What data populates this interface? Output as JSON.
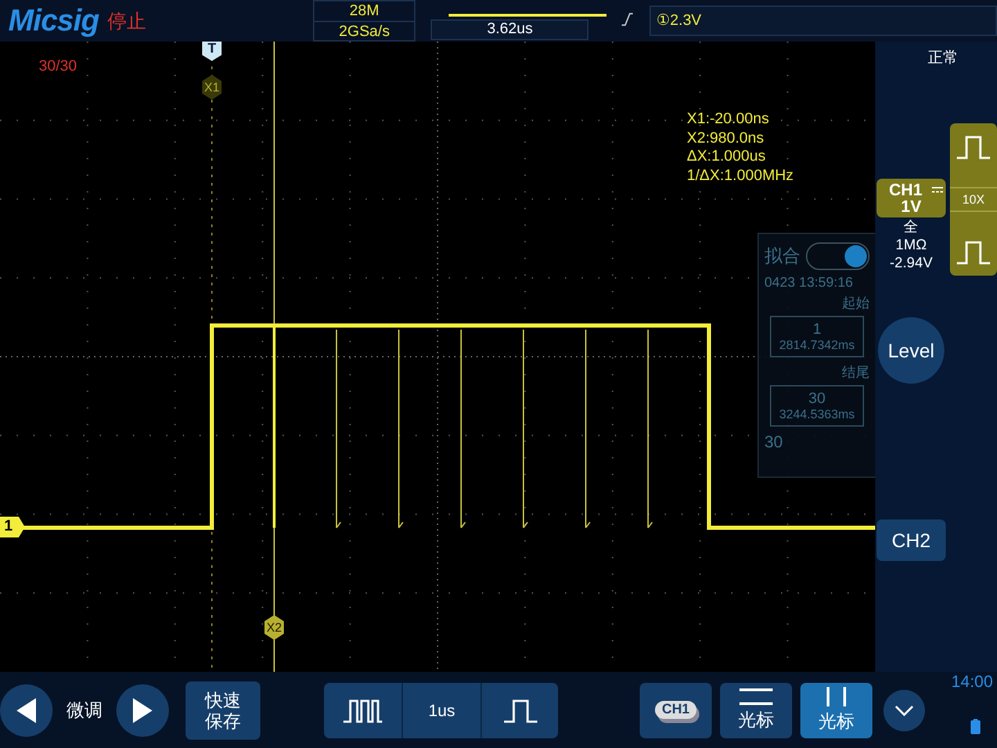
{
  "top_bar": {
    "brand": "Micsig",
    "run_state": "停止",
    "memory_depth": "28M",
    "sample_rate": "2GSa/s",
    "trigger_position": "3.62us",
    "trigger_readout": "①2.3V"
  },
  "plot": {
    "frame_count": "30/30",
    "trigger_marker": "T",
    "channel_marker": "1",
    "cursor_readouts": [
      "X1:-20.00ns",
      "X2:980.0ns",
      "ΔX:1.000us",
      "1/ΔX:1.000MHz"
    ],
    "cursors": [
      {
        "label": "X1",
        "kind": "dashed"
      },
      {
        "label": "X2",
        "kind": "solid"
      }
    ]
  },
  "segment_panel": {
    "mode_label": "拟合",
    "mode_on": true,
    "timestamp": "0423 13:59:16",
    "start_label": "起始",
    "start": {
      "index": "1",
      "time": "2814.7342ms"
    },
    "end_label": "结尾",
    "end": {
      "index": "30",
      "time": "3244.5363ms"
    },
    "count": "30"
  },
  "side_panel": {
    "acquire_mode": "正常",
    "probe_ratio": "10X",
    "channel": {
      "name": "CH1",
      "scale": "1V",
      "bandwidth": "全",
      "impedance": "1MΩ",
      "offset": "-2.94V"
    },
    "level_button": "Level",
    "ch2_button": "CH2"
  },
  "bottom_bar": {
    "fine_label": "微调",
    "quick_save": "快速保存",
    "timebase": "1us",
    "channel_button": "CH1",
    "cursor_buttons": [
      {
        "label": "光标",
        "kind": "horizontal",
        "selected": false
      },
      {
        "label": "光标",
        "kind": "vertical",
        "selected": true
      }
    ],
    "clock": "14:00"
  }
}
